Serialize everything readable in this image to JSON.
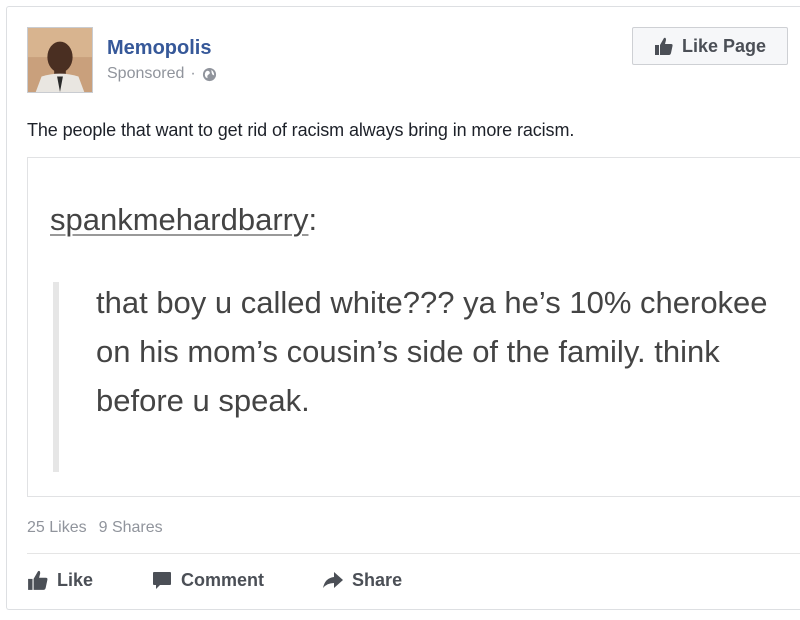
{
  "post": {
    "page_name": "Memopolis",
    "sponsored": "Sponsored",
    "dot": "·",
    "like_page_label": "Like Page",
    "text": "The people that want to get rid of racism always bring in more racism."
  },
  "embed": {
    "username": "spankmehardbarry",
    "colon": ":",
    "quote": "that boy u called white??? ya he’s 10% cherokee on his mom’s cousin’s side of the family. think before u speak."
  },
  "stats": {
    "likes": "25 Likes",
    "shares": "9 Shares"
  },
  "actions": {
    "like": "Like",
    "comment": "Comment",
    "share": "Share"
  },
  "colors": {
    "link_blue": "#365899",
    "muted_gray": "#90949c",
    "action_gray": "#4b4f56"
  },
  "icons": {
    "globe": "globe-icon",
    "thumbs_up": "thumbs-up-icon",
    "comment": "comment-icon",
    "share": "share-arrow-icon"
  }
}
